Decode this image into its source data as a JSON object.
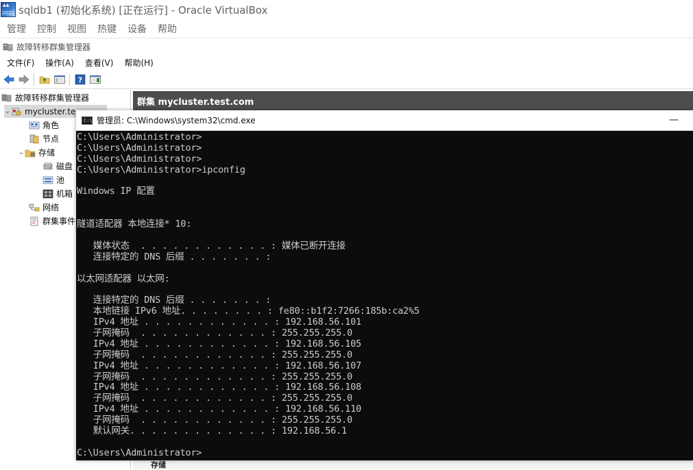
{
  "vbox": {
    "title": "sqldb1 (初始化系统) [正在运行] - Oracle VirtualBox",
    "logo_year": "2022",
    "menu": [
      "管理",
      "控制",
      "视图",
      "热键",
      "设备",
      "帮助"
    ]
  },
  "mmc": {
    "title": "故障转移群集管理器",
    "menu": [
      "文件(F)",
      "操作(A)",
      "查看(V)",
      "帮助(H)"
    ],
    "toolbar": [
      "back-arrow-icon",
      "forward-arrow-icon",
      "up-folder-icon",
      "console-tree-icon",
      "help-icon",
      "action-pane-icon"
    ]
  },
  "tree": {
    "root": "故障转移群集管理器",
    "cluster": "mycluster.te",
    "items": [
      {
        "label": "角色",
        "icon": "roles-icon"
      },
      {
        "label": "节点",
        "icon": "nodes-icon"
      },
      {
        "label": "存储",
        "icon": "storage-folder-icon"
      },
      {
        "label": "磁盘",
        "icon": "disk-icon"
      },
      {
        "label": "池",
        "icon": "pool-icon"
      },
      {
        "label": "机箱",
        "icon": "enclosure-icon"
      },
      {
        "label": "网络",
        "icon": "network-icon"
      },
      {
        "label": "群集事件",
        "icon": "cluster-events-icon"
      }
    ]
  },
  "right": {
    "header": "群集 mycluster.test.com",
    "fragment": "存储"
  },
  "cmd": {
    "title": "管理员: C:\\Windows\\system32\\cmd.exe",
    "lines": [
      "C:\\Users\\Administrator>",
      "C:\\Users\\Administrator>",
      "C:\\Users\\Administrator>",
      "C:\\Users\\Administrator>ipconfig",
      "",
      "Windows IP 配置",
      "",
      "",
      "隧道适配器 本地连接* 10:",
      "",
      "   媒体状态  . . . . . . . . . . . . : 媒体已断开连接",
      "   连接特定的 DNS 后缀 . . . . . . . :",
      "",
      "以太网适配器 以太网:",
      "",
      "   连接特定的 DNS 后缀 . . . . . . . :",
      "   本地链接 IPv6 地址. . . . . . . . : fe80::b1f2:7266:185b:ca2%5",
      "   IPv4 地址 . . . . . . . . . . . . : 192.168.56.101",
      "   子网掩码  . . . . . . . . . . . . : 255.255.255.0",
      "   IPv4 地址 . . . . . . . . . . . . : 192.168.56.105",
      "   子网掩码  . . . . . . . . . . . . : 255.255.255.0",
      "   IPv4 地址 . . . . . . . . . . . . : 192.168.56.107",
      "   子网掩码  . . . . . . . . . . . . : 255.255.255.0",
      "   IPv4 地址 . . . . . . . . . . . . : 192.168.56.108",
      "   子网掩码  . . . . . . . . . . . . : 255.255.255.0",
      "   IPv4 地址 . . . . . . . . . . . . : 192.168.56.110",
      "   子网掩码  . . . . . . . . . . . . : 255.255.255.0",
      "   默认网关. . . . . . . . . . . . . : 192.168.56.1",
      "",
      "C:\\Users\\Administrator>"
    ]
  }
}
